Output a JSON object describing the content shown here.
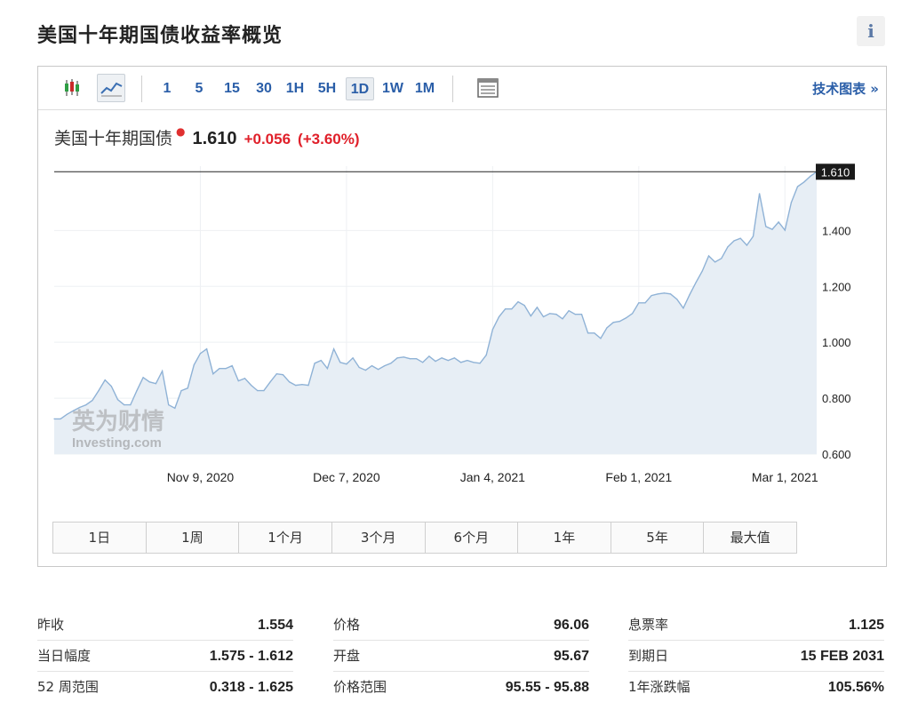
{
  "page": {
    "title": "美国十年期国债收益率概览",
    "info_label": "i"
  },
  "toolbar": {
    "icons": [
      "candlestick-icon",
      "line-chart-icon",
      "table-icon"
    ],
    "intervals": [
      "1",
      "5",
      "15",
      "30",
      "1H",
      "5H",
      "1D",
      "1W",
      "1M"
    ],
    "active_interval": "1D",
    "tech_chart_link": "技术图表 »"
  },
  "quote": {
    "name": "美国十年期国债",
    "price": "1.610",
    "change": "+0.056",
    "change_pct": "(+3.60%)"
  },
  "watermark": {
    "cn": "英为财情",
    "en": "Investing.com"
  },
  "ranges": [
    "1日",
    "1周",
    "1个月",
    "3个月",
    "6个月",
    "1年",
    "5年",
    "最大值"
  ],
  "colors": {
    "accent": "#2a5ea8",
    "up": "#e0202a",
    "line": "#8fb2d6",
    "area": "#e7eef5"
  },
  "chart_data": {
    "type": "area",
    "y_axis_side": "right",
    "ylim": [
      0.6,
      1.63
    ],
    "y_ticks": [
      "0.600",
      "0.800",
      "1.000",
      "1.200",
      "1.400"
    ],
    "x_ticks": [
      "Nov 9, 2020",
      "Dec 7, 2020",
      "Jan 4, 2021",
      "Feb 1, 2021",
      "Mar 1, 2021"
    ],
    "last_value_label": "1.610",
    "grid": true,
    "series": [
      {
        "values": [
          0.726,
          0.726,
          0.742,
          0.755,
          0.767,
          0.776,
          0.792,
          0.827,
          0.865,
          0.843,
          0.795,
          0.776,
          0.776,
          0.827,
          0.874,
          0.858,
          0.852,
          0.897,
          0.776,
          0.764,
          0.827,
          0.836,
          0.919,
          0.96,
          0.976,
          0.887,
          0.906,
          0.906,
          0.916,
          0.862,
          0.871,
          0.846,
          0.827,
          0.827,
          0.858,
          0.887,
          0.884,
          0.858,
          0.846,
          0.849,
          0.846,
          0.925,
          0.935,
          0.906,
          0.976,
          0.928,
          0.922,
          0.944,
          0.91,
          0.9,
          0.916,
          0.903,
          0.916,
          0.925,
          0.944,
          0.947,
          0.941,
          0.941,
          0.928,
          0.95,
          0.932,
          0.944,
          0.935,
          0.944,
          0.928,
          0.935,
          0.928,
          0.925,
          0.954,
          1.046,
          1.091,
          1.119,
          1.119,
          1.145,
          1.132,
          1.094,
          1.125,
          1.091,
          1.103,
          1.1,
          1.084,
          1.113,
          1.1,
          1.1,
          1.033,
          1.033,
          1.014,
          1.052,
          1.071,
          1.075,
          1.087,
          1.103,
          1.141,
          1.141,
          1.167,
          1.173,
          1.176,
          1.173,
          1.154,
          1.122,
          1.17,
          1.214,
          1.255,
          1.309,
          1.287,
          1.3,
          1.341,
          1.363,
          1.372,
          1.347,
          1.379,
          1.532,
          1.414,
          1.404,
          1.43,
          1.401,
          1.5,
          1.557,
          1.573,
          1.594,
          1.61
        ]
      }
    ]
  },
  "stats": [
    {
      "label": "昨收",
      "value": "1.554"
    },
    {
      "label": "价格",
      "value": "96.06"
    },
    {
      "label": "息票率",
      "value": "1.125"
    },
    {
      "label": "当日幅度",
      "value": "1.575 - 1.612"
    },
    {
      "label": "开盘",
      "value": "95.67"
    },
    {
      "label": "到期日",
      "value": "15 FEB 2031"
    },
    {
      "label": "52 周范围",
      "value": "0.318 - 1.625"
    },
    {
      "label": "价格范围",
      "value": "95.55 - 95.88"
    },
    {
      "label": "1年涨跌幅",
      "value": "105.56%"
    }
  ]
}
